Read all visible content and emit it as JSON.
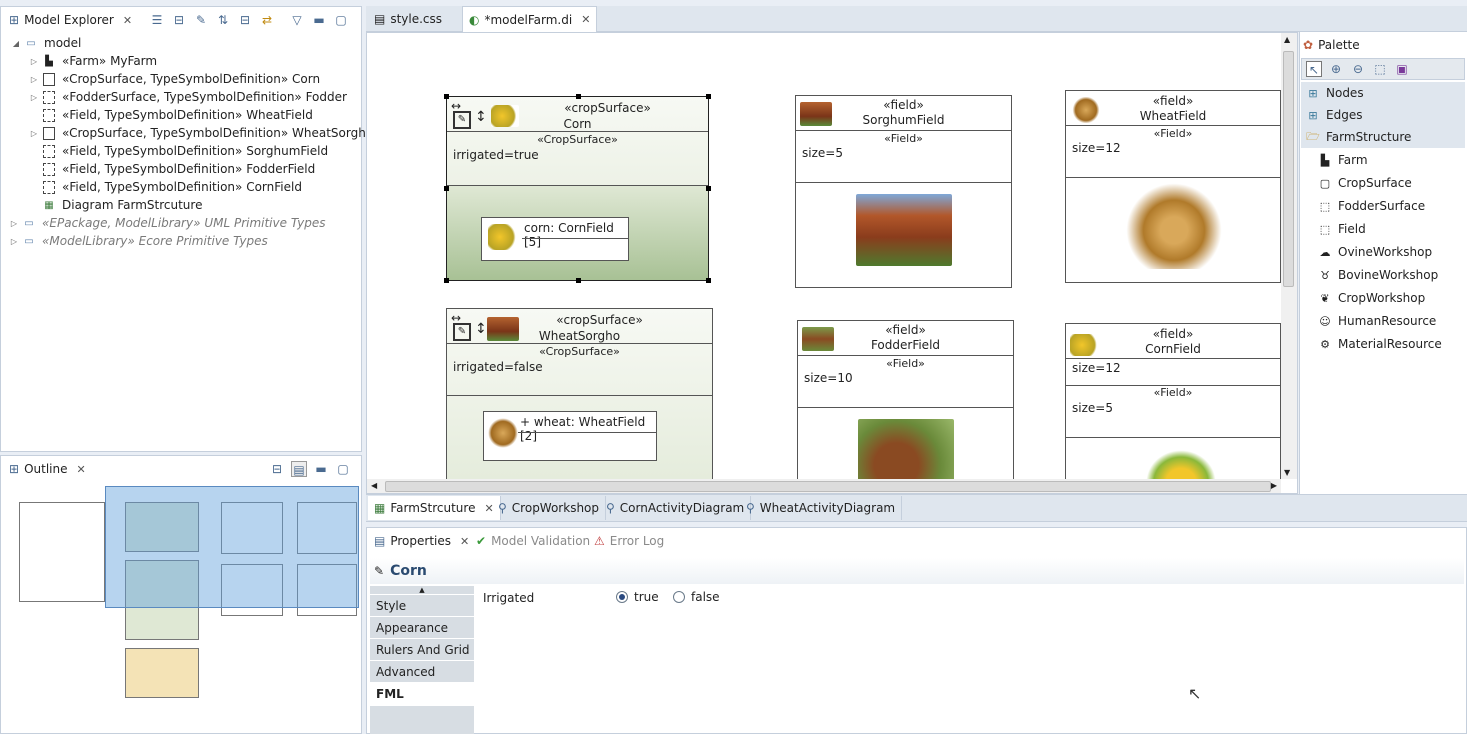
{
  "model_explorer": {
    "title": "Model Explorer",
    "tree": [
      {
        "label": "model",
        "icon": "package-icon",
        "twisty": "open"
      },
      {
        "label": "«Farm» MyFarm",
        "icon": "farm-icon",
        "twisty": "closed"
      },
      {
        "label": "«CropSurface, TypeSymbolDefinition» Corn",
        "icon": "cropsurface-icon",
        "twisty": "closed"
      },
      {
        "label": "«FodderSurface, TypeSymbolDefinition» Fodder",
        "icon": "foddersurface-icon",
        "twisty": "closed"
      },
      {
        "label": "«Field, TypeSymbolDefinition» WheatField",
        "icon": "field-icon",
        "twisty": "none"
      },
      {
        "label": "«CropSurface, TypeSymbolDefinition» WheatSorgho",
        "icon": "cropsurface-icon",
        "twisty": "closed"
      },
      {
        "label": "«Field, TypeSymbolDefinition» SorghumField",
        "icon": "field-icon",
        "twisty": "none"
      },
      {
        "label": "«Field, TypeSymbolDefinition» FodderField",
        "icon": "field-icon",
        "twisty": "none"
      },
      {
        "label": "«Field, TypeSymbolDefinition» CornField",
        "icon": "field-icon",
        "twisty": "none"
      },
      {
        "label": "Diagram FarmStrcuture",
        "icon": "diagram-icon",
        "twisty": "none"
      }
    ],
    "libraries": [
      "«EPackage, ModelLibrary» UML Primitive Types",
      "«ModelLibrary» Ecore Primitive Types"
    ]
  },
  "outline": {
    "title": "Outline"
  },
  "editor_tabs": [
    {
      "label": "style.css",
      "active": false
    },
    {
      "label": "*modelFarm.di",
      "active": true
    }
  ],
  "diagram": {
    "corn": {
      "stereo": "«cropSurface»",
      "name": "Corn",
      "compartment": "«CropSurface»",
      "attr": "irrigated=true",
      "part": "corn: CornField [5]"
    },
    "wheatsorgho": {
      "stereo": "«cropSurface»",
      "name": "WheatSorgho",
      "compartment": "«CropSurface»",
      "attr": "irrigated=false",
      "part": "+ wheat: WheatField [2]"
    },
    "sorghumfield": {
      "stereo": "«field»",
      "name": "SorghumField",
      "compartment": "«Field»",
      "attr": "size=5"
    },
    "fodderfield": {
      "stereo": "«field»",
      "name": "FodderField",
      "compartment": "«Field»",
      "attr": "size=10"
    },
    "wheatfield": {
      "stereo": "«field»",
      "name": "WheatField",
      "compartment": "«Field»",
      "attr": "size=12"
    },
    "cornfield": {
      "stereo": "«field»",
      "name": "CornField",
      "attr1": "size=12",
      "compartment": "«Field»",
      "attr2": "size=5"
    }
  },
  "palette": {
    "title": "Palette",
    "drawers": [
      "Nodes",
      "Edges"
    ],
    "open_drawer": "FarmStructure",
    "items": [
      {
        "label": "Farm",
        "icon": "farm-icon"
      },
      {
        "label": "CropSurface",
        "icon": "cropsurface-icon"
      },
      {
        "label": "FodderSurface",
        "icon": "foddersurface-icon"
      },
      {
        "label": "Field",
        "icon": "field-icon"
      },
      {
        "label": "OvineWorkshop",
        "icon": "sheep-icon"
      },
      {
        "label": "BovineWorkshop",
        "icon": "cow-icon"
      },
      {
        "label": "CropWorkshop",
        "icon": "leaf-icon"
      },
      {
        "label": "HumanResource",
        "icon": "person-icon"
      },
      {
        "label": "MaterialResource",
        "icon": "tractor-icon"
      }
    ]
  },
  "diagram_tabs": [
    {
      "label": "FarmStrcuture",
      "active": true
    },
    {
      "label": "CropWorkshop",
      "active": false
    },
    {
      "label": "CornActivityDiagram",
      "active": false
    },
    {
      "label": "WheatActivityDiagram",
      "active": false
    }
  ],
  "properties": {
    "tabs": [
      "Properties",
      "Model Validation",
      "Error Log"
    ],
    "selected_title": "Corn",
    "sections": [
      "Style",
      "Appearance",
      "Rulers And Grid",
      "Advanced",
      "FML"
    ],
    "active_section": "FML",
    "field_label": "Irrigated",
    "options": [
      "true",
      "false"
    ],
    "selected_option": "true"
  }
}
